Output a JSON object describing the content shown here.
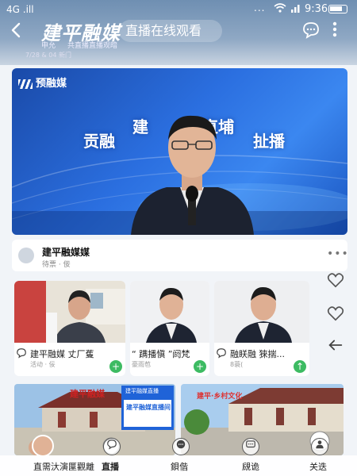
{
  "status_bar": {
    "signal": "4G .ill",
    "dots": "...",
    "time": "9:36"
  },
  "header": {
    "logo": "建平融媒",
    "title": "直播在线观看",
    "sub_left": "申允",
    "sub_right": "共直播直播观暗",
    "sub_line2": "7/28 & 04 新门"
  },
  "video": {
    "logo_text": "预融媒",
    "overlay_1": "建",
    "overlay_2": "直埔",
    "overlay_3": "贡融",
    "overlay_4": "扯播",
    "bg_color": "#2b6fe0"
  },
  "channel": {
    "name": "建平融媒媒",
    "sub": "待票 · 佞",
    "more": "•••"
  },
  "side_actions": {
    "like_icon": "heart-icon",
    "favorite_icon": "heart-outline-icon",
    "share_icon": "arrow-left-icon"
  },
  "cards": [
    {
      "title": "建平融媒 丈厂蒦",
      "sub": "活动 · 佞"
    },
    {
      "title": "“ 蹒播愼 ”阏梵",
      "sub": "豪雨苞"
    },
    {
      "title": "融眹融 猍揣...",
      "sub": "8蓑("
    }
  ],
  "big_cards": [
    {
      "banner": "建平融媒",
      "badge": "建平融媒直播",
      "panel_title": "建平融媒直播间"
    },
    {
      "banner": "建平·乡村文化",
      "badge": ""
    }
  ],
  "bottom_bar": {
    "avatar_text": "直播",
    "left_text": "直需汏演匰觀離",
    "live_label": "直播",
    "chat_label": "鋇偕",
    "comment_label": "覛诡",
    "share_label": "关迭"
  }
}
